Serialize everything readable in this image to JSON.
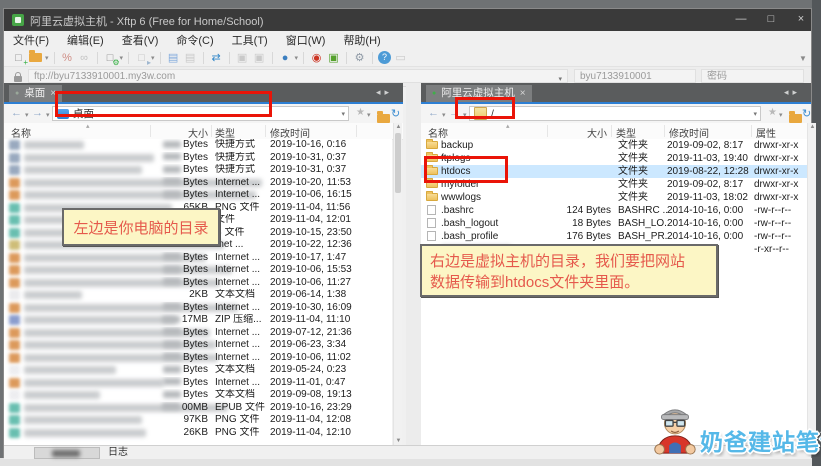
{
  "window": {
    "title": "阿里云虚拟主机 - Xftp 6 (Free for Home/School)",
    "controls": {
      "minimize": "—",
      "maximize": "□",
      "close": "×"
    }
  },
  "menu": {
    "items": [
      "文件(F)",
      "编辑(E)",
      "查看(V)",
      "命令(C)",
      "工具(T)",
      "窗口(W)",
      "帮助(H)"
    ]
  },
  "toolbar": {
    "items": [
      {
        "name": "new-session-icon",
        "glyph": "□",
        "color": "#8f8f8f",
        "badge": "+",
        "badge_color": "#2fae3e"
      },
      {
        "name": "open-session-icon",
        "folder": true,
        "color": "#e9a83f",
        "dropdown": true
      },
      {
        "sep": true
      },
      {
        "name": "disconnect-icon",
        "glyph": "%",
        "color": "#cf8d85"
      },
      {
        "name": "reconnect-icon",
        "glyph": "∞",
        "color": "#c3c3c3"
      },
      {
        "sep": true
      },
      {
        "name": "session-properties-icon",
        "glyph": "□",
        "color": "#8f8f8f",
        "badge": "⚙",
        "badge_color": "#2fae3e",
        "dropdown": true
      },
      {
        "sep": true
      },
      {
        "name": "open-terminal-icon",
        "glyph": "□",
        "color": "#c3c3c3",
        "badge": "▸",
        "badge_color": "#9fb7cf",
        "dropdown": true
      },
      {
        "sep": true
      },
      {
        "name": "new-transfer-icon",
        "glyph": "▤",
        "color": "#7fa9dc"
      },
      {
        "name": "transfer-disabled-icon",
        "glyph": "▤",
        "color": "#c9c9c9"
      },
      {
        "sep": true
      },
      {
        "name": "sync-browsing-icon",
        "glyph": "⇄",
        "color": "#2f86c9"
      },
      {
        "sep": true
      },
      {
        "name": "copy-icon",
        "glyph": "▣",
        "color": "#c9c9c9"
      },
      {
        "name": "paste-icon",
        "glyph": "▣",
        "color": "#c9c9c9"
      },
      {
        "sep": true
      },
      {
        "name": "globe-icon",
        "glyph": "●",
        "color": "#3c7fc0",
        "dropdown": true
      },
      {
        "sep": true
      },
      {
        "name": "xshell-icon",
        "glyph": "◉",
        "color": "#cc3524"
      },
      {
        "name": "xmanager-icon",
        "glyph": "▣",
        "color": "#55a12c"
      },
      {
        "sep": true
      },
      {
        "name": "settings-gear-icon",
        "glyph": "⚙",
        "color": "#8f9aa6"
      },
      {
        "sep": true
      },
      {
        "name": "help-icon",
        "glyph": "?",
        "color": "#ffffff",
        "bg": "#4d9bd6",
        "round": true
      },
      {
        "name": "feedback-icon",
        "glyph": "▭",
        "color": "#c9c9c9"
      }
    ]
  },
  "connection_bar": {
    "url": "ftp://byu7133910001.my3w.com",
    "username": "byu7133910001",
    "password_placeholder": "密码"
  },
  "left_panel": {
    "tab_label": "桌面",
    "path": "桌面",
    "columns": [
      "名称",
      "大小",
      "类型",
      "修改时间"
    ],
    "rows": [
      {
        "size": "Bytes",
        "size_blurred": true,
        "type": "快捷方式",
        "date": "2019-10-16, 0:16",
        "blur_w": 60,
        "icon_color": "#8ea0b8"
      },
      {
        "size": "Bytes",
        "size_blurred": true,
        "type": "快捷方式",
        "date": "2019-10-31, 0:37",
        "blur_w": 130,
        "icon_color": "#8ea0b8"
      },
      {
        "size": "Bytes",
        "size_blurred": true,
        "type": "快捷方式",
        "date": "2019-10-31, 0:37",
        "blur_w": 118,
        "icon_color": "#8ea0b8"
      },
      {
        "size": "Bytes",
        "size_blurred": true,
        "type": "Internet ...",
        "date": "2019-10-20, 11:53",
        "blur_w": 238,
        "icon_color": "#d98f4a"
      },
      {
        "size": "Bytes",
        "size_blurred": true,
        "type": "Internet ...",
        "date": "2019-10-06, 16:15",
        "blur_w": 232,
        "icon_color": "#d98f4a"
      },
      {
        "size": "65KB",
        "size_blurred": false,
        "type": "PNG 文件",
        "date": "2019-11-04, 11:56",
        "blur_w": 148,
        "icon_color": "#58b8a8"
      },
      {
        "size": "",
        "size_blurred": false,
        "type": "文件",
        "date": "2019-11-04, 12:01",
        "blur_w": 130,
        "icon_color": "#58b8a8"
      },
      {
        "size": "",
        "size_blurred": false,
        "type": "B 文件",
        "date": "2019-10-15, 23:50",
        "blur_w": 120,
        "icon_color": "#58b8a8"
      },
      {
        "size": "",
        "size_blurred": false,
        "type": "rnet ...",
        "date": "2019-10-22, 12:36",
        "blur_w": 200,
        "icon_color": "#c9b66a"
      },
      {
        "size": "Bytes",
        "size_blurred": true,
        "type": "Internet ...",
        "date": "2019-10-17, 1:47",
        "blur_w": 182,
        "icon_color": "#d98f4a"
      },
      {
        "size": "Bytes",
        "size_blurred": true,
        "type": "Internet ...",
        "date": "2019-10-06, 15:53",
        "blur_w": 208,
        "icon_color": "#d98f4a"
      },
      {
        "size": "Bytes",
        "size_blurred": true,
        "type": "Internet ...",
        "date": "2019-10-06, 11:27",
        "blur_w": 196,
        "icon_color": "#d98f4a"
      },
      {
        "size": "2KB",
        "size_blurred": false,
        "type": "文本文档",
        "date": "2019-06-14, 1:38",
        "blur_w": 58,
        "icon_color": "#e9e9ec"
      },
      {
        "size": "Bytes",
        "size_blurred": true,
        "type": "Internet ...",
        "date": "2019-10-30, 16:09",
        "blur_w": 214,
        "icon_color": "#d98f4a"
      },
      {
        "size": "17MB",
        "size_blurred": true,
        "type": "ZIP 压缩...",
        "date": "2019-11-04, 11:10",
        "blur_w": 152,
        "icon_color": "#7f93c9"
      },
      {
        "size": "Bytes",
        "size_blurred": true,
        "type": "Internet ...",
        "date": "2019-07-12, 21:36",
        "blur_w": 186,
        "icon_color": "#d98f4a"
      },
      {
        "size": "Bytes",
        "size_blurred": true,
        "type": "Internet ...",
        "date": "2019-06-23, 3:34",
        "blur_w": 192,
        "icon_color": "#d98f4a"
      },
      {
        "size": "Bytes",
        "size_blurred": true,
        "type": "Internet ...",
        "date": "2019-10-06, 11:02",
        "blur_w": 194,
        "icon_color": "#d98f4a"
      },
      {
        "size": "Bytes",
        "size_blurred": true,
        "type": "文本文档",
        "date": "2019-05-24, 0:23",
        "blur_w": 92,
        "icon_color": "#ececef"
      },
      {
        "size": "Bytes",
        "size_blurred": true,
        "type": "Internet ...",
        "date": "2019-11-01, 0:47",
        "blur_w": 140,
        "icon_color": "#d98f4a"
      },
      {
        "size": "Bytes",
        "size_blurred": true,
        "type": "文本文档",
        "date": "2019-09-08, 19:13",
        "blur_w": 76,
        "icon_color": "#ececef"
      },
      {
        "size": "00MB",
        "size_blurred": true,
        "type": "EPUB 文件",
        "date": "2019-10-16, 23:29",
        "blur_w": 204,
        "icon_color": "#58b8a8"
      },
      {
        "size": "97KB",
        "size_blurred": false,
        "type": "PNG 文件",
        "date": "2019-11-04, 12:08",
        "blur_w": 118,
        "icon_color": "#58b8a8"
      },
      {
        "size": "26KB",
        "size_blurred": false,
        "type": "PNG 文件",
        "date": "2019-11-04, 12:10",
        "blur_w": 122,
        "icon_color": "#58b8a8"
      }
    ]
  },
  "right_panel": {
    "tab_label": "阿里云虚拟主机",
    "path": "/",
    "columns": [
      "名称",
      "大小",
      "类型",
      "修改时间",
      "属性"
    ],
    "rows": [
      {
        "name": "backup",
        "kind": "folder",
        "size": "",
        "type": "文件夹",
        "date": "2019-09-02, 8:17",
        "attr": "drwxr-xr-x",
        "selected": false
      },
      {
        "name": "ftplogs",
        "kind": "folder",
        "size": "",
        "type": "文件夹",
        "date": "2019-11-03, 19:40",
        "attr": "drwxr-xr-x",
        "selected": false
      },
      {
        "name": "htdocs",
        "kind": "folder",
        "size": "",
        "type": "文件夹",
        "date": "2019-08-22, 12:28",
        "attr": "drwxr-xr-x",
        "selected": true
      },
      {
        "name": "myfolder",
        "kind": "folder",
        "size": "",
        "type": "文件夹",
        "date": "2019-09-02, 8:17",
        "attr": "drwxr-xr-x",
        "selected": false
      },
      {
        "name": "wwwlogs",
        "kind": "folder",
        "size": "",
        "type": "文件夹",
        "date": "2019-11-03, 18:02",
        "attr": "drwxr-xr-x",
        "selected": false
      },
      {
        "name": ".bashrc",
        "kind": "file",
        "size": "124 Bytes",
        "type": "BASHRC ...",
        "date": "2014-10-16, 0:00",
        "attr": "-rw-r--r--",
        "selected": false
      },
      {
        "name": ".bash_logout",
        "kind": "file",
        "size": "18 Bytes",
        "type": "BASH_LO...",
        "date": "2014-10-16, 0:00",
        "attr": "-rw-r--r--",
        "selected": false
      },
      {
        "name": ".bash_profile",
        "kind": "file",
        "size": "176 Bytes",
        "type": "BASH_PR...",
        "date": "2014-10-16, 0:00",
        "attr": "-rw-r--r--",
        "selected": false
      },
      {
        "name": "",
        "kind": "file",
        "size": "",
        "type": "",
        "date": "",
        "attr": "-r-xr--r--",
        "selected": false,
        "name_blurred": true,
        "blur_w": 70
      }
    ]
  },
  "annotations": {
    "left_note": {
      "text": "左边是你电脑的目录"
    },
    "right_note": {
      "line1": "右边是虚拟主机的目录，我们要把网站",
      "line2": "数据传输到htdocs文件夹里面。"
    }
  },
  "status_bar": {
    "log_tab": "日志"
  },
  "watermark": {
    "text": "奶爸建站笔记"
  },
  "colors": {
    "titlebar": "#3a3a3a",
    "accent_blue_line": "#2d7fd3",
    "selection": "#cce8ff",
    "annotation_red": "#ea1408",
    "note_bg": "#fcf6c5",
    "note_text": "#e5594c",
    "watermark_blue": "#55b8e8",
    "tab_green_dot": "#3fae49"
  }
}
